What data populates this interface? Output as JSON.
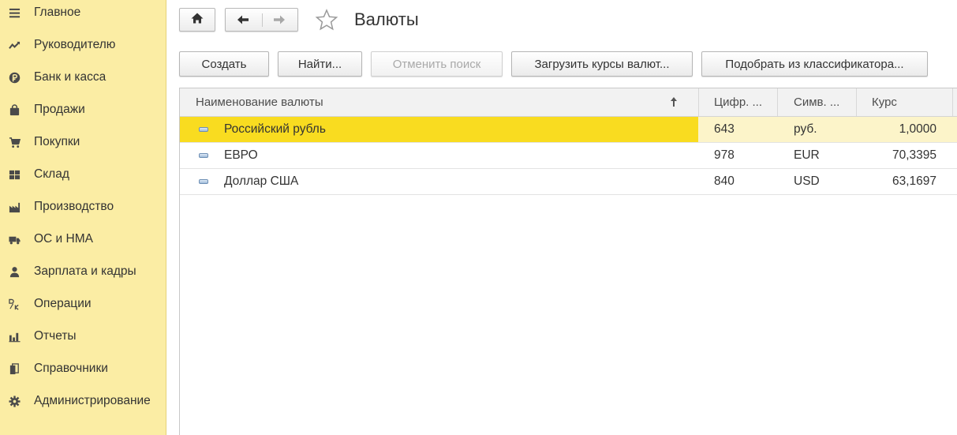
{
  "sidebar": {
    "items": [
      {
        "label": "Главное",
        "icon": "menu-icon"
      },
      {
        "label": "Руководителю",
        "icon": "trend-chart-icon"
      },
      {
        "label": "Банк и касса",
        "icon": "ruble-coin-icon"
      },
      {
        "label": "Продажи",
        "icon": "shopping-bag-icon"
      },
      {
        "label": "Покупки",
        "icon": "shopping-cart-icon"
      },
      {
        "label": "Склад",
        "icon": "warehouse-grid-icon"
      },
      {
        "label": "Производство",
        "icon": "factory-icon"
      },
      {
        "label": "ОС и НМА",
        "icon": "truck-icon"
      },
      {
        "label": "Зарплата и кадры",
        "icon": "person-icon"
      },
      {
        "label": "Операции",
        "icon": "dt-kt-operations-icon"
      },
      {
        "label": "Отчеты",
        "icon": "bar-chart-icon"
      },
      {
        "label": "Справочники",
        "icon": "books-icon"
      },
      {
        "label": "Администрирование",
        "icon": "gear-icon"
      }
    ]
  },
  "header": {
    "title": "Валюты",
    "home_icon": "home-icon",
    "back_icon": "arrow-left-icon",
    "forward_icon": "arrow-right-icon",
    "favorite_icon": "star-icon"
  },
  "toolbar": {
    "create": "Создать",
    "find": "Найти...",
    "cancel_search": "Отменить поиск",
    "load_rates": "Загрузить курсы валют...",
    "pick_from_classifier": "Подобрать из классификатора..."
  },
  "table": {
    "columns": {
      "name": "Наименование валюты",
      "code": "Цифр. ...",
      "symbol": "Симв. ...",
      "rate": "Курс"
    },
    "rows": [
      {
        "name": "Российский рубль",
        "code": "643",
        "symbol": "руб.",
        "rate": "1,0000",
        "selected": true
      },
      {
        "name": "ЕВРО",
        "code": "978",
        "symbol": "EUR",
        "rate": "70,3395",
        "selected": false
      },
      {
        "name": "Доллар США",
        "code": "840",
        "symbol": "USD",
        "rate": "63,1697",
        "selected": false
      }
    ]
  },
  "colors": {
    "sidebar_bg": "#fbeda4",
    "selected_row": "#f9dc20",
    "selected_row_light": "#fcf4c9"
  }
}
